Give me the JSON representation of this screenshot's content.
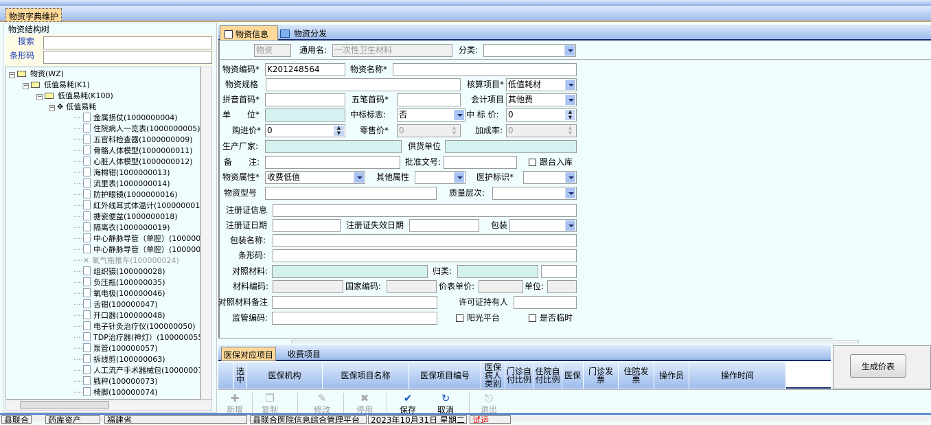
{
  "window": {
    "tab": "物资字典维护"
  },
  "left": {
    "group_title": "物资结构树",
    "search_label": "搜索",
    "search_value": "",
    "barcode_label": "条形码",
    "barcode_value": "",
    "tree": [
      {
        "level": 0,
        "type": "folder",
        "label": "物资(WZ)"
      },
      {
        "level": 1,
        "type": "folder",
        "label": "低值易耗(K1)"
      },
      {
        "level": 2,
        "type": "folder",
        "label": "低值易耗(K100)"
      },
      {
        "level": 3,
        "type": "category",
        "label": "低值易耗"
      },
      {
        "level": 4,
        "type": "doc",
        "label": "金属拐仗(1000000004)"
      },
      {
        "level": 4,
        "type": "doc",
        "label": "住院病人一览表(1000000005)"
      },
      {
        "level": 4,
        "type": "doc",
        "label": "五官科检查器(1000000009)"
      },
      {
        "level": 4,
        "type": "doc",
        "label": "骨骼人体模型(1000000011)"
      },
      {
        "level": 4,
        "type": "doc",
        "label": "心脏人体模型(1000000012)"
      },
      {
        "level": 4,
        "type": "doc",
        "label": "海棉钳(1000000013)"
      },
      {
        "level": 4,
        "type": "doc",
        "label": "流里表(1000000014)"
      },
      {
        "level": 4,
        "type": "doc",
        "label": "防护眼镜(1000000016)"
      },
      {
        "level": 4,
        "type": "doc",
        "label": "红外线耳式体温计(1000000017)"
      },
      {
        "level": 4,
        "type": "doc",
        "label": "搪瓷便盆(1000000018)"
      },
      {
        "level": 4,
        "type": "doc",
        "label": "隔离衣(1000000019)"
      },
      {
        "level": 4,
        "type": "doc",
        "label": "中心静脉导管（单腔）(1000000"
      },
      {
        "level": 4,
        "type": "doc",
        "label": "中心静脉导管（单腔）(1000000"
      },
      {
        "level": 4,
        "type": "disabled",
        "label": "氧气瓶推车(100000024)"
      },
      {
        "level": 4,
        "type": "doc",
        "label": "组织镊(100000028)"
      },
      {
        "level": 4,
        "type": "doc",
        "label": "负压瓶(100000035)"
      },
      {
        "level": 4,
        "type": "doc",
        "label": "氧电极(100000046)"
      },
      {
        "level": 4,
        "type": "doc",
        "label": "舌钳(100000047)"
      },
      {
        "level": 4,
        "type": "doc",
        "label": "开口器(100000048)"
      },
      {
        "level": 4,
        "type": "doc",
        "label": "电子针灸治疗仪(100000050)"
      },
      {
        "level": 4,
        "type": "doc",
        "label": "TDP治疗器(神灯）(100000055)"
      },
      {
        "level": 4,
        "type": "doc",
        "label": "泵管(100000057)"
      },
      {
        "level": 4,
        "type": "doc",
        "label": "拆线剪(100000063)"
      },
      {
        "level": 4,
        "type": "doc",
        "label": "人工流产手术器械包(100000072"
      },
      {
        "level": 4,
        "type": "doc",
        "label": "戥秤(100000073)"
      },
      {
        "level": 4,
        "type": "doc",
        "label": "椅脚(100000074)"
      }
    ]
  },
  "tabs": {
    "info": "物资信息",
    "distribute": "物资分发"
  },
  "form": {
    "kind": "物资",
    "generic_label": "通用名:",
    "generic_value": "一次性卫生材料",
    "category_label": "分类:",
    "category_value": "",
    "code_label": "物资编码*",
    "code_value": "K201248564",
    "name_label": "物资名称*",
    "name_value": "",
    "spec_label": "物资规格",
    "spec_value": "",
    "acct_item_label": "核算项目*",
    "acct_item_value": "低值耗材",
    "pinyin_label": "拼音首码*",
    "pinyin_value": "",
    "wubi_label": "五笔首码*",
    "wubi_value": "",
    "account_label": "会计项目",
    "account_value": "其他费",
    "unit_label": "单　　位*",
    "unit_value": "",
    "bid_flag_label": "中标标志:",
    "bid_flag_value": "否",
    "bid_price_label": "中 标 价:",
    "bid_price_value": "0",
    "purchase_label": "购进价*",
    "purchase_value": "0",
    "retail_label": "零售价*",
    "retail_value": "0",
    "markup_label": "加成率:",
    "markup_value": "0",
    "maker_label": "生产厂家:",
    "maker_value": "",
    "supplier_label": "供货单位",
    "supplier_value": "",
    "remark_label": "备　　注:",
    "remark_value": "",
    "approval_label": "批准文号:",
    "approval_value": "",
    "follow_label": "跟台入库",
    "follow_checked": false,
    "attr_label": "物资属性*",
    "attr_value": "收费低值",
    "other_attr_label": "其他属性",
    "other_attr_value": "",
    "nurse_label": "医护标识*",
    "nurse_value": "",
    "model_label": "物资型号",
    "model_value": "",
    "quality_label": "质量层次:",
    "quality_value": "",
    "reg_info_label": "注册证信息",
    "reg_info_value": "",
    "reg_date_label": "注册证日期",
    "reg_date_value": "",
    "reg_expire_label": "注册证失效日期",
    "reg_expire_value": "",
    "pack_label": "包装",
    "pack_value": "",
    "pack_name_label": "包装名称:",
    "pack_name_value": "",
    "barcode_label": "条形码:",
    "barcode_value": "",
    "ref_label": "对照材料:",
    "ref_value": "",
    "class_label": "归类:",
    "class_value": "",
    "class_extra": "",
    "mat_code_label": "材料编码:",
    "mat_code_value": "",
    "nat_code_label": "国家编码:",
    "nat_code_value": "",
    "price_label": "价表单价:",
    "price_value": "",
    "unit2_label": "单位:",
    "unit2_value": "",
    "ref_note_label": "对照材料备注",
    "ref_note_value": "",
    "holder_label": "许可证持有人",
    "holder_value": "",
    "sup_code_label": "监管编码:",
    "sup_code_value": "",
    "sunshine_label": "阳光平台",
    "sunshine_checked": false,
    "temp_label": "是否临时",
    "temp_checked": false
  },
  "bottom_tabs": {
    "insurance": "医保对应项目",
    "charge": "收费项目"
  },
  "grid": {
    "columns": [
      "选中",
      "医保机构",
      "医保项目名称",
      "医保项目编号",
      "医保病人类别",
      "门诊自付比例",
      "住院自付比例",
      "医保",
      "门诊发票",
      "住院发票",
      "操作员",
      "操作时间"
    ]
  },
  "side": {
    "generate": "生成价表"
  },
  "toolbar": {
    "add": "新增(A)",
    "copy": "复制(N)",
    "edit": "修改(E)",
    "disable": "停用(T)",
    "save": "保存(S)",
    "cancel": "取消(C)",
    "exit": "退出(X)"
  },
  "status": [
    "县联合",
    "药库资产",
    "福建省",
    "县联合医院信息综合管理平台",
    "2023年10月31日 星期二",
    "试运"
  ],
  "colors": {
    "header_blue": "#9dbcec",
    "tab_active": "#ffd99a",
    "panel": "#f0fdff",
    "readonly_teal": "#d4f2ef"
  }
}
